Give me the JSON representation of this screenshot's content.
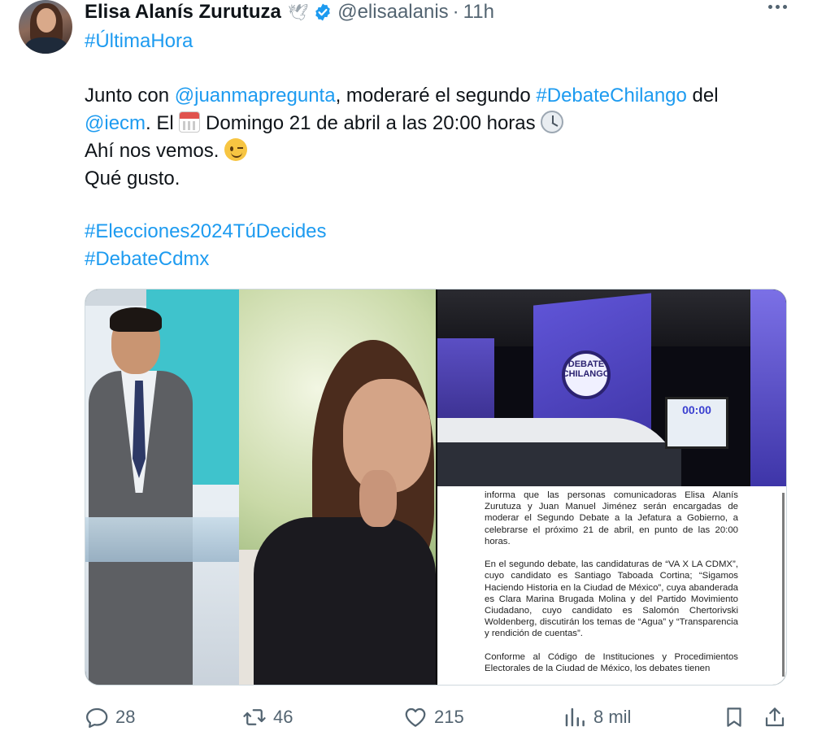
{
  "author": {
    "name": "Elisa Alanís Zurutuza",
    "handle": "@elisaalanis",
    "time": "11h"
  },
  "tweet": {
    "line1": "#ÚltimaHora",
    "line2_pre": "Junto con ",
    "line2_mention": "@juanmapregunta",
    "line2_mid": ", moderaré el segundo ",
    "line2_hashtag": "#DebateChilango",
    "line2_post": " del",
    "line3_mention": "@iecm",
    "line3_pre": ". El ",
    "line3_mid": " Domingo 21 de abril a las 20:00 horas ",
    "line4": "Ahí nos vemos. ",
    "line5": "Qué gusto.",
    "hashtag1": "#Elecciones2024TúDecides",
    "hashtag2": "#DebateCdmx"
  },
  "media": {
    "studio_logo_text": "DEBATE CHILANGO",
    "studio_monitor_text": "00:00",
    "doc_paragraphs": [
      "informa que las personas comunicadoras Elisa Alanís Zurutuza y Juan Manuel Jiménez serán encargadas de moderar el Segundo Debate a la Jefatura a Gobierno, a celebrarse el próximo 21 de abril, en punto de las 20:00 horas.",
      "En el segundo debate, las candidaturas de “VA X LA CDMX”, cuyo candidato es Santiago Taboada Cortina; “Sigamos Haciendo Historia en la Ciudad de México”, cuya abanderada es Clara Marina Brugada Molina y del Partido Movimiento Ciudadano, cuyo candidato es Salomón Chertorivski Woldenberg, discutirán los temas de “Agua” y “Transparencia y rendición de cuentas”.",
      "Conforme al Código de Instituciones y Procedimientos Electorales de la Ciudad de México, los debates tienen"
    ]
  },
  "actions": {
    "replies": "28",
    "reposts": "46",
    "likes": "215",
    "views": "8 mil"
  },
  "colors": {
    "link": "#1d9bf0",
    "muted": "#536471",
    "text": "#0f1419"
  }
}
